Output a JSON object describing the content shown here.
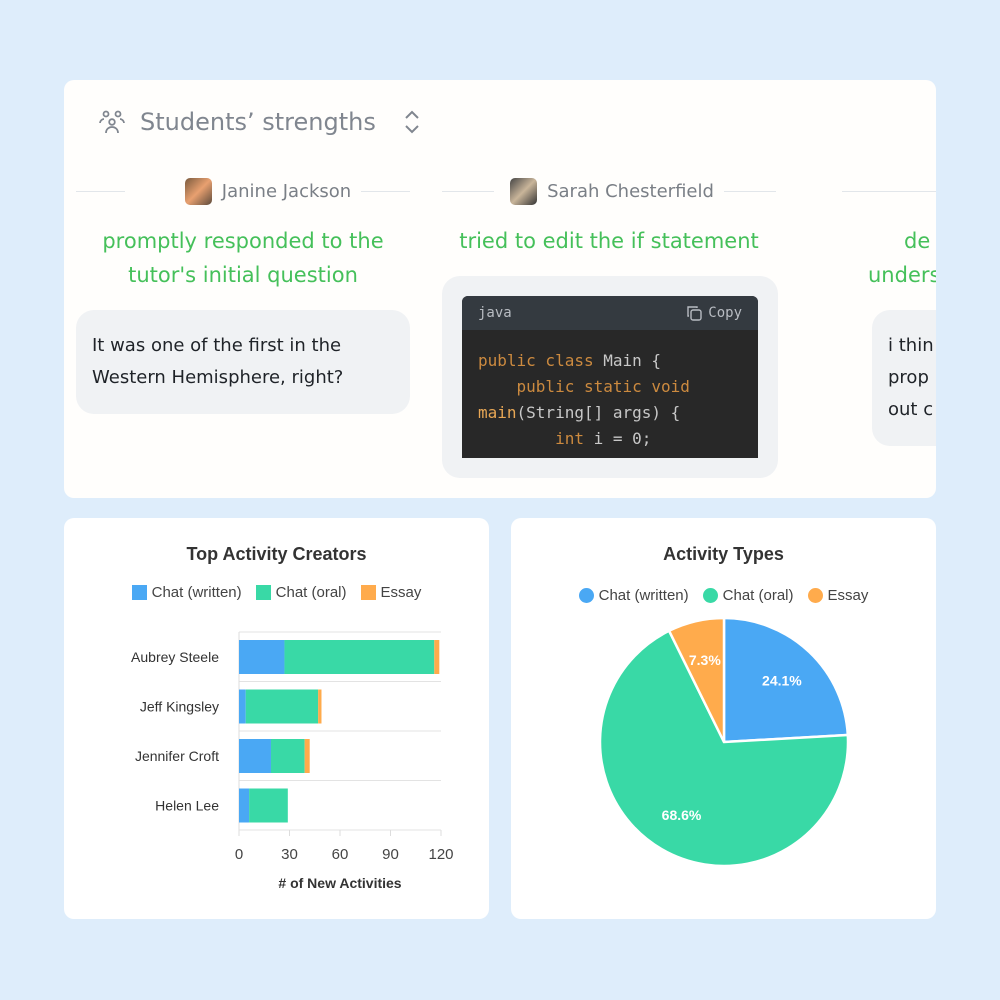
{
  "header": {
    "title": "Students’ strengths",
    "icon": "users-icon",
    "toggle_icon": "chevron-up-down-icon"
  },
  "students": [
    {
      "name": "Janine Jackson",
      "strength": "promptly responded to the tutor's initial question",
      "message": "It was one of the first in the Western Hemisphere, right?"
    },
    {
      "name": "Sarah Chesterfield",
      "strength": "tried to edit the if statement",
      "code": {
        "language": "java",
        "copy_label": "Copy",
        "lines": [
          "public class Main {",
          "    public static void",
          "main(String[] args) {",
          "        int i = 0;"
        ]
      }
    },
    {
      "name": "",
      "strength": "de... unders...",
      "strength_lines": [
        "de",
        "unders"
      ],
      "message_lines": [
        "i thin",
        "prop",
        "out c"
      ]
    }
  ],
  "colors": {
    "written": "#4aa8f4",
    "oral": "#39d9a6",
    "essay": "#ffab4c",
    "strength_text": "#45c05a"
  },
  "chart_data": [
    {
      "type": "bar",
      "orientation": "horizontal",
      "stacked": true,
      "title": "Top Activity Creators",
      "xlabel": "# of New Activities",
      "xlim": [
        0,
        120
      ],
      "xticks": [
        0,
        30,
        60,
        90,
        120
      ],
      "legend": "top",
      "categories": [
        "Aubrey Steele",
        "Jeff Kingsley",
        "Jennifer Croft",
        "Helen Lee"
      ],
      "series": [
        {
          "name": "Chat (written)",
          "values": [
            27,
            4,
            19,
            6
          ]
        },
        {
          "name": "Chat (oral)",
          "values": [
            89,
            43,
            20,
            23
          ]
        },
        {
          "name": "Essay",
          "values": [
            3,
            2,
            3,
            0
          ]
        }
      ]
    },
    {
      "type": "pie",
      "title": "Activity Types",
      "legend": "top",
      "categories": [
        "Chat (written)",
        "Chat (oral)",
        "Essay"
      ],
      "values": [
        24.1,
        68.6,
        7.3
      ],
      "labels": [
        "24.1%",
        "68.6%",
        "7.3%"
      ]
    }
  ]
}
